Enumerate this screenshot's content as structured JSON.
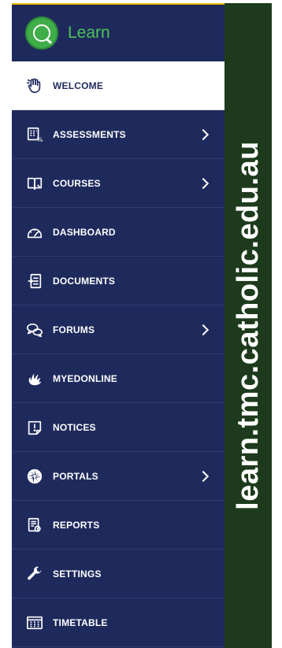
{
  "brand": {
    "name": "Learn",
    "accent": "#4cc35a"
  },
  "nav": {
    "items": [
      {
        "label": "WELCOME",
        "icon": "hand-icon",
        "active": true,
        "has_submenu": false
      },
      {
        "label": "ASSESSMENTS",
        "icon": "assessment-icon",
        "active": false,
        "has_submenu": true
      },
      {
        "label": "COURSES",
        "icon": "book-icon",
        "active": false,
        "has_submenu": true
      },
      {
        "label": "DASHBOARD",
        "icon": "gauge-icon",
        "active": false,
        "has_submenu": false
      },
      {
        "label": "DOCUMENTS",
        "icon": "document-icon",
        "active": false,
        "has_submenu": false
      },
      {
        "label": "FORUMS",
        "icon": "chat-icon",
        "active": false,
        "has_submenu": true
      },
      {
        "label": "MYEDONLINE",
        "icon": "myedonline-icon",
        "active": false,
        "has_submenu": false
      },
      {
        "label": "NOTICES",
        "icon": "notice-icon",
        "active": false,
        "has_submenu": false
      },
      {
        "label": "PORTALS",
        "icon": "portal-icon",
        "active": false,
        "has_submenu": true
      },
      {
        "label": "REPORTS",
        "icon": "report-icon",
        "active": false,
        "has_submenu": false
      },
      {
        "label": "SETTINGS",
        "icon": "wrench-icon",
        "active": false,
        "has_submenu": false
      },
      {
        "label": "TIMETABLE",
        "icon": "calendar-icon",
        "active": false,
        "has_submenu": false
      }
    ]
  },
  "banner": {
    "text": "learn.tmc.catholic.edu.au"
  },
  "colors": {
    "sidebar_bg": "#1f2a5c",
    "banner_bg": "#1d3b1c",
    "active_bg": "#ffffff"
  }
}
